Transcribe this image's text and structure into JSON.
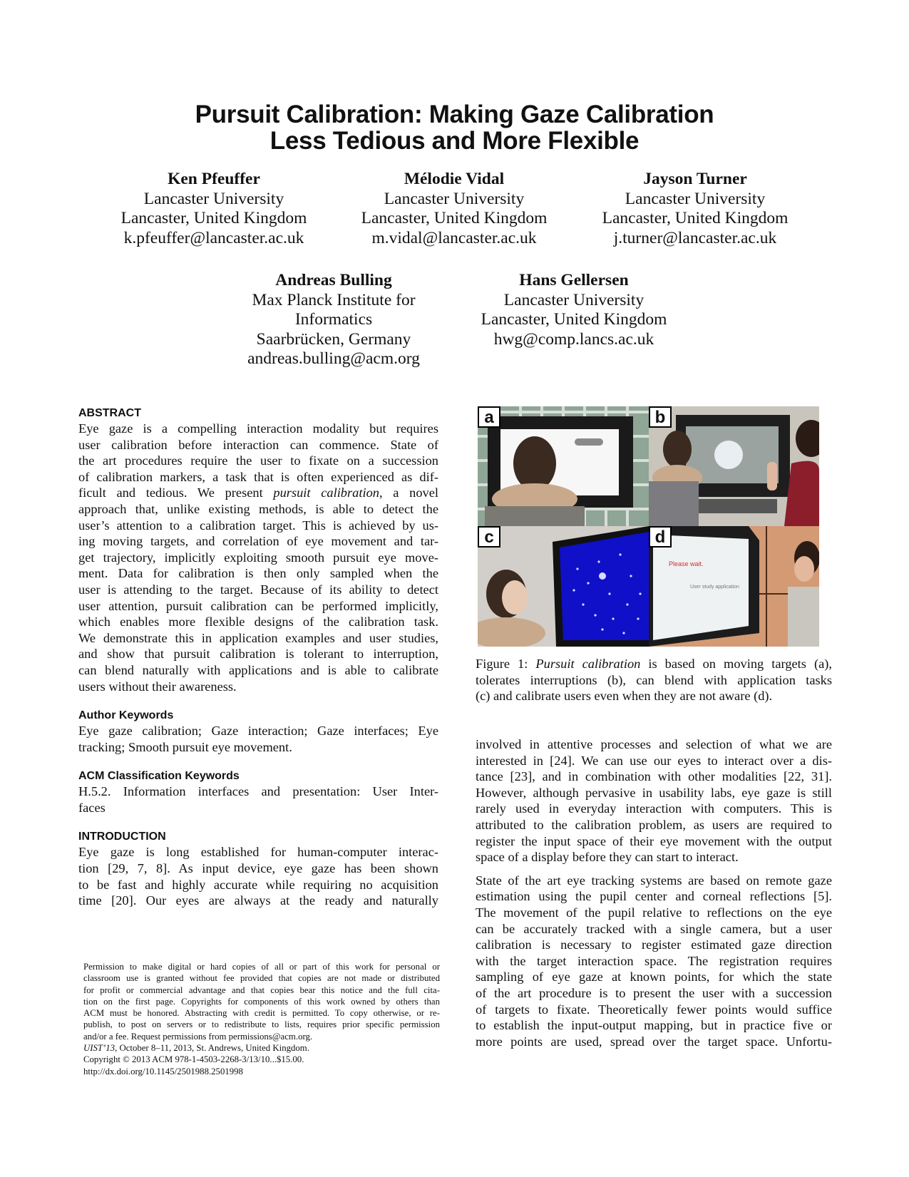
{
  "paper": {
    "title_lines": [
      "Pursuit Calibration: Making Gaze Calibration",
      "Less Tedious and More Flexible"
    ],
    "authors": [
      {
        "name": "Ken Pfeuffer",
        "lines": [
          "Lancaster University",
          "Lancaster, United Kingdom",
          "k.pfeuffer@lancaster.ac.uk"
        ]
      },
      {
        "name": "Mélodie Vidal",
        "lines": [
          "Lancaster University",
          "Lancaster, United Kingdom",
          "m.vidal@lancaster.ac.uk"
        ]
      },
      {
        "name": "Jayson Turner",
        "lines": [
          "Lancaster University",
          "Lancaster, United Kingdom",
          "j.turner@lancaster.ac.uk"
        ]
      },
      {
        "name": "Andreas Bulling",
        "lines": [
          "Max Planck Institute for",
          "Informatics",
          "Saarbrücken, Germany",
          "andreas.bulling@acm.org"
        ]
      },
      {
        "name": "Hans Gellersen",
        "lines": [
          "Lancaster University",
          "Lancaster, United Kingdom",
          "hwg@comp.lancs.ac.uk"
        ]
      }
    ],
    "abstract": {
      "heading": "ABSTRACT",
      "lines": [
        "Eye gaze is a compelling interaction modality but requires",
        "user calibration before interaction can commence.  State of",
        "the art procedures require the user to fixate on a succession",
        "of calibration markers, a task that is often experienced as dif-",
        "ficult and tedious.  We present ",
        "approach that, unlike existing methods, is able to detect the",
        "user’s attention to a calibration target. This is achieved by us-",
        "ing moving targets, and correlation of eye movement and tar-",
        "get trajectory, implicitly exploiting smooth pursuit eye move-",
        "ment.  Data for calibration is then only sampled when the",
        "user is attending to the target. Because of its ability to detect",
        "user attention, pursuit calibration can be performed implicitly,",
        "which enables more flexible designs of the calibration task.",
        "We demonstrate this in application examples and user studies,",
        "and show that pursuit calibration is tolerant to interruption,",
        "can blend naturally with applications and is able to calibrate",
        "users without their awareness."
      ],
      "italic_term": "pursuit calibration",
      "line5_tail": ", a novel"
    },
    "author_keywords": {
      "heading": "Author Keywords",
      "lines": [
        "Eye gaze calibration; Gaze interaction; Gaze interfaces; Eye",
        "tracking; Smooth pursuit eye movement."
      ]
    },
    "acm_keywords": {
      "heading": "ACM Classification Keywords",
      "lines": [
        "H.5.2.  Information interfaces and presentation:  User Inter-",
        "faces"
      ]
    },
    "introduction": {
      "heading": "INTRODUCTION",
      "lines": [
        "Eye gaze is long established for human-computer interac-",
        "tion [29, 7, 8].  As input device, eye gaze has been shown",
        "to be fast and highly accurate while requiring no acquisition",
        "time [20].  Our eyes are always at the ready and naturally"
      ]
    },
    "footer": {
      "lines": [
        "Permission to make digital or hard copies of all or part of this work for personal or",
        "classroom use is granted without fee provided that copies are not made or distributed",
        "for profit or commercial advantage and that copies bear this notice and the full cita-",
        "tion on the first page.  Copyrights for components of this work owned by others than",
        "ACM must be honored. Abstracting with credit is permitted. To copy otherwise, or re-",
        "publish, to post on servers or to redistribute to lists, requires prior specific permission",
        "and/or a fee. Request permissions from permissions@acm.org."
      ],
      "venue_italic": "UIST’13",
      "venue_rest": ", October 8–11, 2013, St. Andrews, United Kingdom.",
      "copyright": "Copyright © 2013 ACM 978-1-4503-2268-3/13/10...$15.00.",
      "doi": "http://dx.doi.org/10.1145/2501988.2501998"
    },
    "figure": {
      "panels": [
        "a",
        "b",
        "c",
        "d"
      ],
      "screen_text_d": [
        "Please wait.",
        "User study application"
      ],
      "caption_prefix": "Figure 1: ",
      "caption_italic": "Pursuit calibration",
      "caption_lines": [
        " is based on moving targets (a),",
        "tolerates interruptions (b), can blend with application tasks",
        "(c) and calibrate users even when they are not aware (d)."
      ]
    },
    "right_column": {
      "para1": [
        "involved in attentive processes and selection of what we are",
        "interested in [24].  We can use our eyes to interact over a dis-",
        "tance [23], and in combination with other modalities [22, 31].",
        "However, although pervasive in usability labs, eye gaze is still",
        "rarely used in everyday interaction with computers.  This is",
        "attributed to the calibration problem, as users are required to",
        "register the input space of their eye movement with the output",
        "space of a display before they can start to interact."
      ],
      "para2": [
        "State of the art eye tracking systems are based on remote gaze",
        "estimation using the pupil center and corneal reflections [5].",
        "The movement of the pupil relative to reflections on the eye",
        "can be accurately tracked with a single camera, but a user",
        "calibration is necessary to register estimated gaze direction",
        "with the target interaction space.  The registration requires",
        "sampling of eye gaze at known points, for which the state",
        "of the art procedure is to present the user with a succession",
        "of targets to fixate.  Theoretically fewer points would suffice",
        "to establish the input-output mapping, but in practice five or",
        "more points are used, spread over the target space.  Unfortu-"
      ]
    }
  }
}
